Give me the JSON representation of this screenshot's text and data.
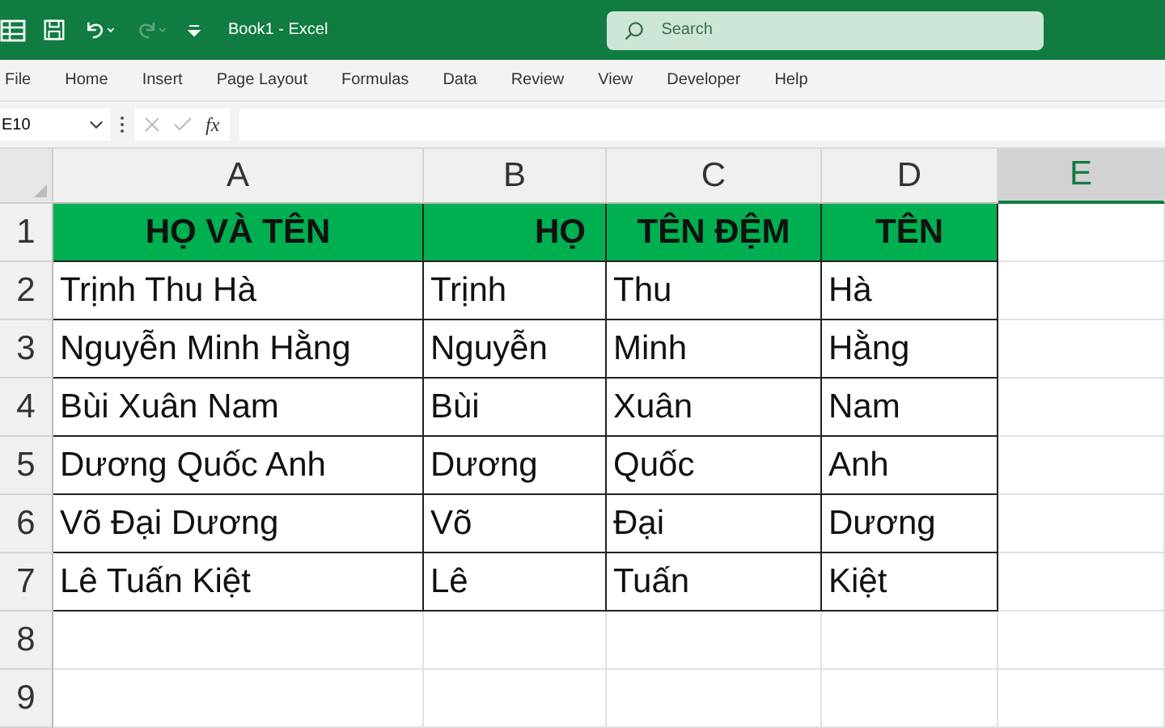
{
  "window": {
    "title": "Book1  -  Excel"
  },
  "search": {
    "placeholder": "Search"
  },
  "menu": [
    {
      "label": "File"
    },
    {
      "label": "Home"
    },
    {
      "label": "Insert"
    },
    {
      "label": "Page Layout"
    },
    {
      "label": "Formulas"
    },
    {
      "label": "Data"
    },
    {
      "label": "Review"
    },
    {
      "label": "View"
    },
    {
      "label": "Developer"
    },
    {
      "label": "Help"
    }
  ],
  "formula_bar": {
    "name_box": "E10",
    "fx": "fx"
  },
  "columns": [
    {
      "label": "A",
      "selected": false
    },
    {
      "label": "B",
      "selected": false
    },
    {
      "label": "C",
      "selected": false
    },
    {
      "label": "D",
      "selected": false
    },
    {
      "label": "E",
      "selected": true
    }
  ],
  "rows": [
    {
      "number": "1",
      "kind": "header",
      "cells": [
        "HỌ VÀ TÊN",
        "HỌ",
        "TÊN ĐỆM",
        "TÊN"
      ]
    },
    {
      "number": "2",
      "kind": "data",
      "cells": [
        "Trịnh Thu Hà",
        "Trịnh",
        "Thu",
        "Hà"
      ]
    },
    {
      "number": "3",
      "kind": "data",
      "cells": [
        "Nguyễn Minh Hằng",
        "Nguyễn",
        "Minh",
        "Hằng"
      ]
    },
    {
      "number": "4",
      "kind": "data",
      "cells": [
        "Bùi Xuân Nam",
        "Bùi",
        "Xuân",
        "Nam"
      ]
    },
    {
      "number": "5",
      "kind": "data",
      "cells": [
        "Dương Quốc Anh",
        "Dương",
        "Quốc",
        "Anh"
      ]
    },
    {
      "number": "6",
      "kind": "data",
      "cells": [
        "Võ Đại Dương",
        "Võ",
        "Đại",
        "Dương"
      ]
    },
    {
      "number": "7",
      "kind": "data",
      "cells": [
        "Lê Tuấn Kiệt",
        "Lê",
        "Tuấn",
        "Kiệt"
      ]
    },
    {
      "number": "8",
      "kind": "empty",
      "cells": []
    },
    {
      "number": "9",
      "kind": "empty",
      "cells": []
    }
  ]
}
